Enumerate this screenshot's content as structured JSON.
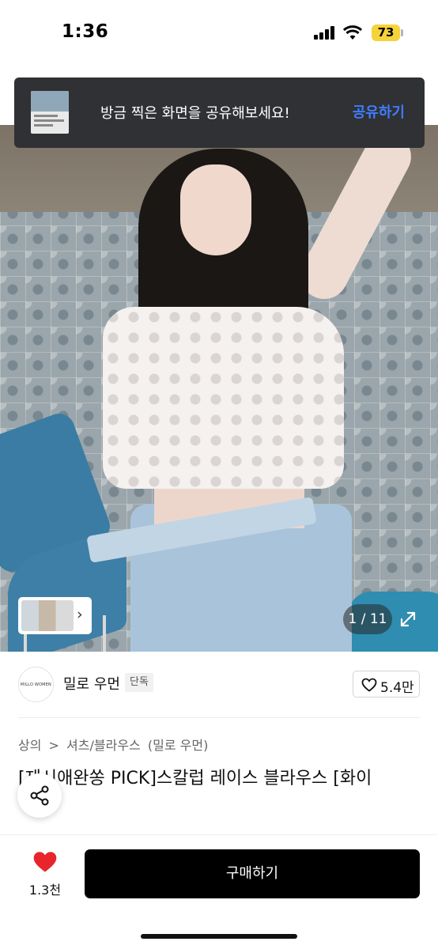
{
  "status_bar": {
    "time": "1:36",
    "battery": "73"
  },
  "toast": {
    "message": "방금 찍은 화면을 공유해보세요!",
    "action": "공유하기"
  },
  "gallery": {
    "counter": "1 / 11"
  },
  "seller": {
    "logo_text": "MILLO WOMEN",
    "name": "밀로 우먼",
    "badge": "단독",
    "likes": "5.4만"
  },
  "breadcrumb": [
    "상의",
    ">",
    "셔츠/블라우스",
    "(밀로 우먼)"
  ],
  "product": {
    "title": "[제시애완쏭 PICK]스칼럽 레이스 블라우스 [화이"
  },
  "bottom": {
    "wish_count": "1.3천",
    "buy_label": "구매하기"
  },
  "colors": {
    "accent_blue": "#3f7dff",
    "heart_red": "#e8252b",
    "buy_button": "#000000"
  }
}
